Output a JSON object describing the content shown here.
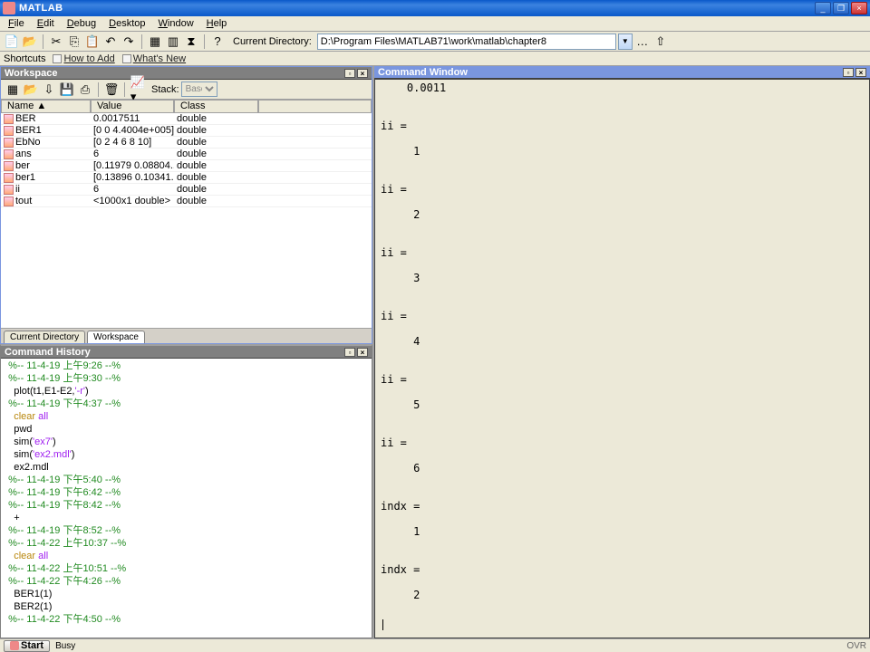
{
  "titlebar": {
    "title": "MATLAB"
  },
  "menu": {
    "items": [
      "File",
      "Edit",
      "Debug",
      "Desktop",
      "Window",
      "Help"
    ]
  },
  "toolbar": {
    "current_directory_label": "Current Directory:",
    "current_directory_value": "D:\\Program Files\\MATLAB71\\work\\matlab\\chapter8"
  },
  "shortcuts": {
    "label": "Shortcuts",
    "items": [
      "How to Add",
      "What's New"
    ]
  },
  "workspace": {
    "title": "Workspace",
    "stack_label": "Stack:",
    "stack_value": "Base",
    "columns": {
      "name": "Name ▲",
      "value": "Value",
      "class": "Class"
    },
    "rows": [
      {
        "name": "BER",
        "value": "0.0017511",
        "class": "double"
      },
      {
        "name": "BER1",
        "value": "[0 0 4.4004e+005]",
        "class": "double"
      },
      {
        "name": "EbNo",
        "value": "[0 2 4 6 8 10]",
        "class": "double"
      },
      {
        "name": "ans",
        "value": "6",
        "class": "double"
      },
      {
        "name": "ber",
        "value": "[0.11979 0.08804...",
        "class": "double"
      },
      {
        "name": "ber1",
        "value": "[0.13896 0.10341...",
        "class": "double"
      },
      {
        "name": "ii",
        "value": "6",
        "class": "double"
      },
      {
        "name": "tout",
        "value": "<1000x1 double>",
        "class": "double"
      }
    ],
    "tabs": {
      "current_directory": "Current Directory",
      "workspace": "Workspace"
    }
  },
  "history": {
    "title": "Command History",
    "lines": [
      {
        "indent": 1,
        "text": "%-- 11-4-19 上午9:26 --%",
        "style": "green"
      },
      {
        "indent": 1,
        "text": "%-- 11-4-19 上午9:30 --%",
        "style": "green"
      },
      {
        "indent": 2,
        "text": "plot(t1,E1-E2,'-r')",
        "style": "plot"
      },
      {
        "indent": 1,
        "text": "%-- 11-4-19 下午4:37 --%",
        "style": "green"
      },
      {
        "indent": 2,
        "text": "clear all",
        "style": "clear"
      },
      {
        "indent": 2,
        "text": "pwd",
        "style": "black"
      },
      {
        "indent": 2,
        "text": "sim('ex7')",
        "style": "sim"
      },
      {
        "indent": 2,
        "text": "sim('ex2.mdl')",
        "style": "sim"
      },
      {
        "indent": 2,
        "text": "ex2.mdl",
        "style": "black"
      },
      {
        "indent": 1,
        "text": "%-- 11-4-19 下午5:40 --%",
        "style": "green"
      },
      {
        "indent": 1,
        "text": "%-- 11-4-19 下午6:42 --%",
        "style": "green"
      },
      {
        "indent": 1,
        "text": "%-- 11-4-19 下午8:42 --%",
        "style": "green"
      },
      {
        "indent": 2,
        "text": "+",
        "style": "black"
      },
      {
        "indent": 1,
        "text": "%-- 11-4-19 下午8:52 --%",
        "style": "green"
      },
      {
        "indent": 1,
        "text": "%-- 11-4-22 上午10:37 --%",
        "style": "green"
      },
      {
        "indent": 2,
        "text": "clear all",
        "style": "clear"
      },
      {
        "indent": 1,
        "text": "%-- 11-4-22 上午10:51 --%",
        "style": "green"
      },
      {
        "indent": 1,
        "text": "%-- 11-4-22 下午4:26 --%",
        "style": "green"
      },
      {
        "indent": 2,
        "text": "BER1(1)",
        "style": "black"
      },
      {
        "indent": 2,
        "text": "BER2(1)",
        "style": "black"
      },
      {
        "indent": 1,
        "text": "%-- 11-4-22 下午4:50 --%",
        "style": "green"
      }
    ]
  },
  "command_window": {
    "title": "Command Window",
    "output": "    0.0011\n\n\nii =\n\n     1\n\n\nii =\n\n     2\n\n\nii =\n\n     3\n\n\nii =\n\n     4\n\n\nii =\n\n     5\n\n\nii =\n\n     6\n\n\nindx =\n\n     1\n\n\nindx =\n\n     2\n\n"
  },
  "statusbar": {
    "start": "Start",
    "status": "Busy",
    "right": "OVR"
  }
}
